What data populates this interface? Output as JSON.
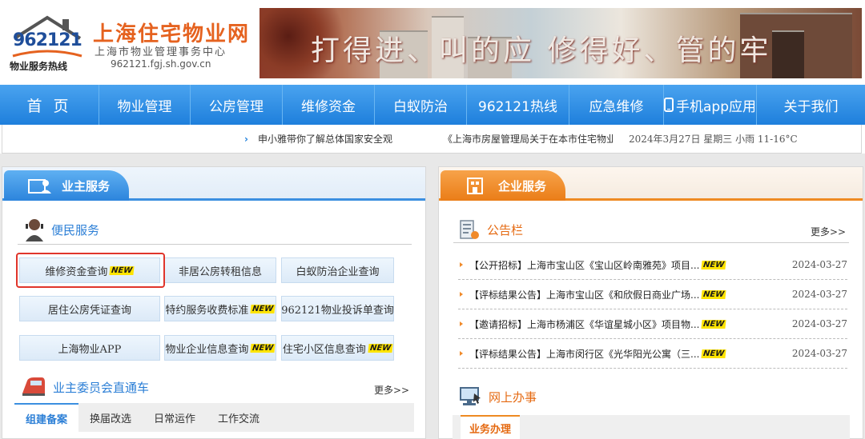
{
  "header": {
    "logo_number": "962121",
    "logo_hotline": "物业服务热线",
    "site_title": "上海住宅物业网",
    "site_subtitle": "上海市物业管理事务中心",
    "site_url": "962121.fgj.sh.gov.cn",
    "banner_slogan": "打得进、叫的应  修得好、管的牢"
  },
  "nav": {
    "items": [
      {
        "label": "首 页"
      },
      {
        "label": "物业管理"
      },
      {
        "label": "公房管理"
      },
      {
        "label": "维修资金"
      },
      {
        "label": "白蚁防治"
      },
      {
        "label": "962121热线"
      },
      {
        "label": "应急维修"
      },
      {
        "label": "手机app应用"
      },
      {
        "label": "关于我们"
      }
    ]
  },
  "ticker": {
    "item1": "申小雅带你了解总体国家安全观",
    "item2": "《上海市房屋管理局关于在本市住宅物业",
    "date_weather": "2024年3月27日 星期三 小雨   11-16°C"
  },
  "left_panel": {
    "tab_label": "业主服务",
    "convenience": {
      "title": "便民服务",
      "buttons": [
        {
          "label": "维修资金查询",
          "new": true
        },
        {
          "label": "非居公房转租信息",
          "new": false
        },
        {
          "label": "白蚁防治企业查询",
          "new": false
        },
        {
          "label": "居住公房凭证查询",
          "new": false
        },
        {
          "label": "特约服务收费标准",
          "new": true
        },
        {
          "label": "962121物业投诉单查询",
          "new": false
        },
        {
          "label": "上海物业APP",
          "new": false
        },
        {
          "label": "物业企业信息查询",
          "new": true
        },
        {
          "label": "住宅小区信息查询",
          "new": true
        }
      ],
      "new_badge": "NEW"
    },
    "committee": {
      "title": "业主委员会直通车",
      "more": "更多>>",
      "tabs": [
        "组建备案",
        "换届改选",
        "日常运作",
        "工作交流"
      ]
    }
  },
  "right_panel": {
    "tab_label": "企业服务",
    "bulletin": {
      "title": "公告栏",
      "more": "更多>>",
      "items": [
        {
          "text": "【公开招标】上海市宝山区《宝山区岭南雅苑》项目...",
          "date": "2024-03-27"
        },
        {
          "text": "【评标结果公告】上海市宝山区《和欣假日商业广场...",
          "date": "2024-03-27"
        },
        {
          "text": "【邀请招标】上海市杨浦区《华谊星城小区》项目物...",
          "date": "2024-03-27"
        },
        {
          "text": "【评标结果公告】上海市闵行区《光华阳光公寓（三...",
          "date": "2024-03-27"
        }
      ]
    },
    "online": {
      "title": "网上办事",
      "tab": "业务办理"
    }
  },
  "colors": {
    "nav_blue": "#1e7fdc",
    "orange": "#ea7d17",
    "highlight_red": "#e0352b"
  }
}
